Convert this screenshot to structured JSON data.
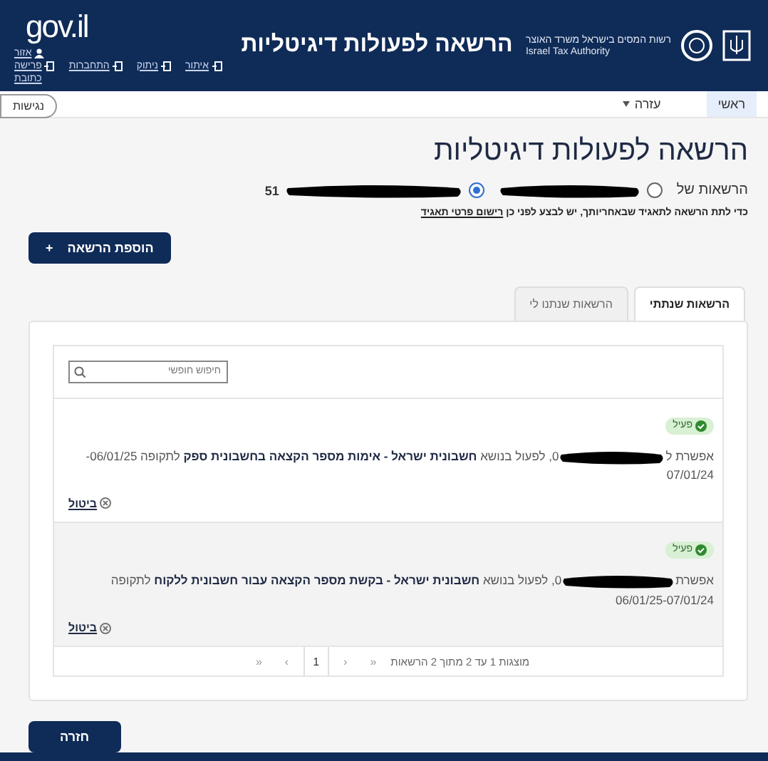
{
  "header": {
    "site_logo": "gov.il",
    "user_link": "אזור",
    "links": [
      "איתור",
      "ניתוק",
      "התחברות",
      "פרישה"
    ],
    "extra_link": "כתובת",
    "title": "הרשאה לפעולות דיגיטליות",
    "authority_he": "רשות המסים בישראל משרד האוצר",
    "authority_en": "Israel Tax Authority"
  },
  "nav": {
    "items": [
      {
        "label": "ראשי",
        "selected": true,
        "dropdown": false
      },
      {
        "label": "עזרה",
        "selected": false,
        "dropdown": true
      }
    ],
    "accessibility": "נגישות"
  },
  "page_title": "הרשאה לפעולות דיגיטליות",
  "permissions_of": {
    "label": "הרשאות של",
    "options": [
      {
        "selected": false
      },
      {
        "prefix": "51",
        "selected": true
      }
    ]
  },
  "note": {
    "text": "כדי לתת הרשאה לתאגיד שבאחריותך, יש לבצע לפני כן",
    "link": "רישום פרטי תאגיד"
  },
  "add_button": {
    "label": "הוספת הרשאה",
    "icon": "+"
  },
  "tabs": [
    {
      "label": "הרשאות שנתתי",
      "selected": true
    },
    {
      "label": "הרשאות שנתנו לי",
      "selected": false
    }
  ],
  "search": {
    "placeholder": "חיפוש חופשי"
  },
  "permissions": [
    {
      "status": "פעיל",
      "highlighted": false,
      "before": "אפשרת ל",
      "after": "0, לפעול בנושא **חשבונית ישראל - אימות מספר הקצאה בחשבונית ספק** לתקופה 06/01/25-",
      "after_line2": "07/01/24",
      "cancel": "ביטול"
    },
    {
      "status": "פעיל",
      "highlighted": true,
      "before": "אפשרת",
      "after": "0, לפעול בנושא **חשבונית ישראל - בקשת מספר הקצאה עבור חשבונית ללקוח** לתקופה",
      "after_line2": "06/01/25-07/01/24",
      "cancel": "ביטול"
    }
  ],
  "pagination": {
    "summary": "מוצגות 1 עד 2 מתוך 2 הרשאות",
    "controls": [
      {
        "label": "«",
        "selected": false
      },
      {
        "label": "‹",
        "selected": false
      },
      {
        "label": "1",
        "selected": true
      },
      {
        "label": "›",
        "selected": false
      },
      {
        "label": "«",
        "selected": false
      }
    ]
  },
  "back_button": "חזרה"
}
